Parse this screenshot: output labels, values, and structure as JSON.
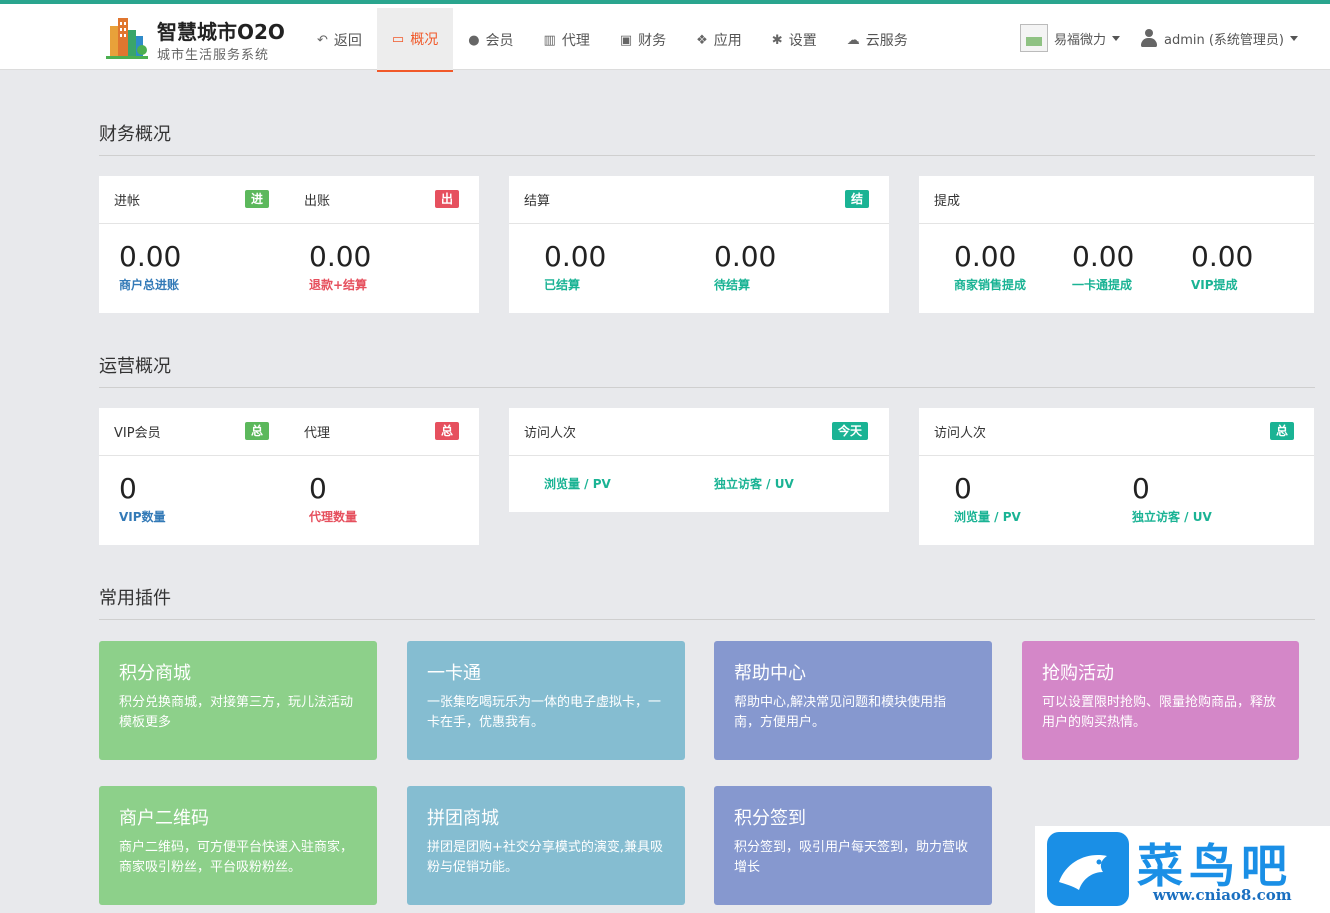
{
  "brand": {
    "title": "智慧城市O2O",
    "subtitle": "城市生活服务系统"
  },
  "nav": [
    {
      "label": "返回",
      "icon": "reply-icon"
    },
    {
      "label": "概况",
      "icon": "monitor-icon",
      "active": true
    },
    {
      "label": "会员",
      "icon": "user-icon"
    },
    {
      "label": "代理",
      "icon": "map-icon"
    },
    {
      "label": "财务",
      "icon": "money-icon"
    },
    {
      "label": "应用",
      "icon": "cubes-icon"
    },
    {
      "label": "设置",
      "icon": "gear-icon"
    },
    {
      "label": "云服务",
      "icon": "cloud-icon"
    }
  ],
  "account": {
    "store": "易福微力",
    "user": "admin (系统管理员)"
  },
  "sections": {
    "finance": "财务概况",
    "operations": "运营概况",
    "plugins": "常用插件"
  },
  "finance": {
    "income": {
      "label": "进帐",
      "badge": "进",
      "value": "0.00",
      "caption": "商户总进账"
    },
    "expense": {
      "label": "出账",
      "badge": "出",
      "value": "0.00",
      "caption": "退款+结算"
    },
    "settle": {
      "label": "结算",
      "badge": "结",
      "items": [
        {
          "value": "0.00",
          "caption": "已结算"
        },
        {
          "value": "0.00",
          "caption": "待结算"
        }
      ]
    },
    "withdraw": {
      "label": "提成",
      "items": [
        {
          "value": "0.00",
          "caption": "商家销售提成"
        },
        {
          "value": "0.00",
          "caption": "一卡通提成"
        },
        {
          "value": "0.00",
          "caption": "VIP提成"
        }
      ]
    }
  },
  "operations": {
    "vip": {
      "label": "VIP会员",
      "badge": "总",
      "value": "0",
      "caption": "VIP数量"
    },
    "agent": {
      "label": "代理",
      "badge": "总",
      "value": "0",
      "caption": "代理数量"
    },
    "visits_today": {
      "label": "访问人次",
      "badge": "今天",
      "items": [
        {
          "caption": "浏览量 / PV"
        },
        {
          "caption": "独立访客 / UV"
        }
      ]
    },
    "visits_total": {
      "label": "访问人次",
      "badge": "总",
      "items": [
        {
          "value": "0",
          "caption": "浏览量 / PV"
        },
        {
          "value": "0",
          "caption": "独立访客 / UV"
        }
      ]
    }
  },
  "plugins": [
    {
      "title": "积分商城",
      "desc": "积分兑换商城，对接第三方，玩儿法活动模板更多",
      "color": "#8dd08a"
    },
    {
      "title": "一卡通",
      "desc": "一张集吃喝玩乐为一体的电子虚拟卡，一卡在手，优惠我有。",
      "color": "#85bdd1"
    },
    {
      "title": "帮助中心",
      "desc": "帮助中心,解决常见问题和模块使用指南，方便用户。",
      "color": "#8698cf"
    },
    {
      "title": "抢购活动",
      "desc": "可以设置限时抢购、限量抢购商品，释放用户的购买热情。",
      "color": "#d487c8"
    },
    {
      "title": "商户二维码",
      "desc": "商户二维码，可方便平台快速入驻商家，商家吸引粉丝，平台吸粉粉丝。",
      "color": "#8dd08a"
    },
    {
      "title": "拼团商城",
      "desc": "拼团是团购+社交分享模式的演变,兼具吸粉与促销功能。",
      "color": "#85bdd1"
    },
    {
      "title": "积分签到",
      "desc": "积分签到，吸引用户每天签到，助力营收增长",
      "color": "#8698cf"
    }
  ],
  "watermark": {
    "name": "菜鸟吧",
    "url": "www.cniao8.com"
  }
}
